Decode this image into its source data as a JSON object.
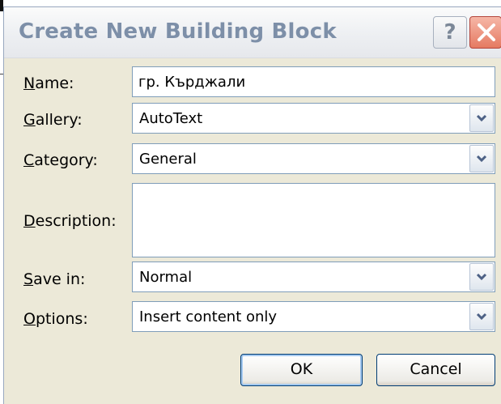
{
  "dialog": {
    "title": "Create New Building Block",
    "help_glyph": "?",
    "close_icon": "close-x-icon"
  },
  "fields": {
    "name": {
      "label_mnemonic": "N",
      "label_rest": "ame:",
      "value": "гр. Кърджали"
    },
    "gallery": {
      "label_mnemonic": "G",
      "label_rest": "allery:",
      "value": "AutoText"
    },
    "category": {
      "label_mnemonic": "C",
      "label_rest": "ategory:",
      "value": "General"
    },
    "description": {
      "label_mnemonic": "D",
      "label_rest": "escription:",
      "value": ""
    },
    "save_in": {
      "label_mnemonic": "S",
      "label_rest": "ave in:",
      "value": "Normal"
    },
    "options": {
      "label_mnemonic": "O",
      "label_rest": "ptions:",
      "value": "Insert content only"
    }
  },
  "buttons": {
    "ok": "OK",
    "cancel": "Cancel"
  },
  "colors": {
    "title_text": "#7d8fa8",
    "dialog_bg": "#ece9d8",
    "field_border": "#7f9db9",
    "close_bg": "#e57a62"
  }
}
